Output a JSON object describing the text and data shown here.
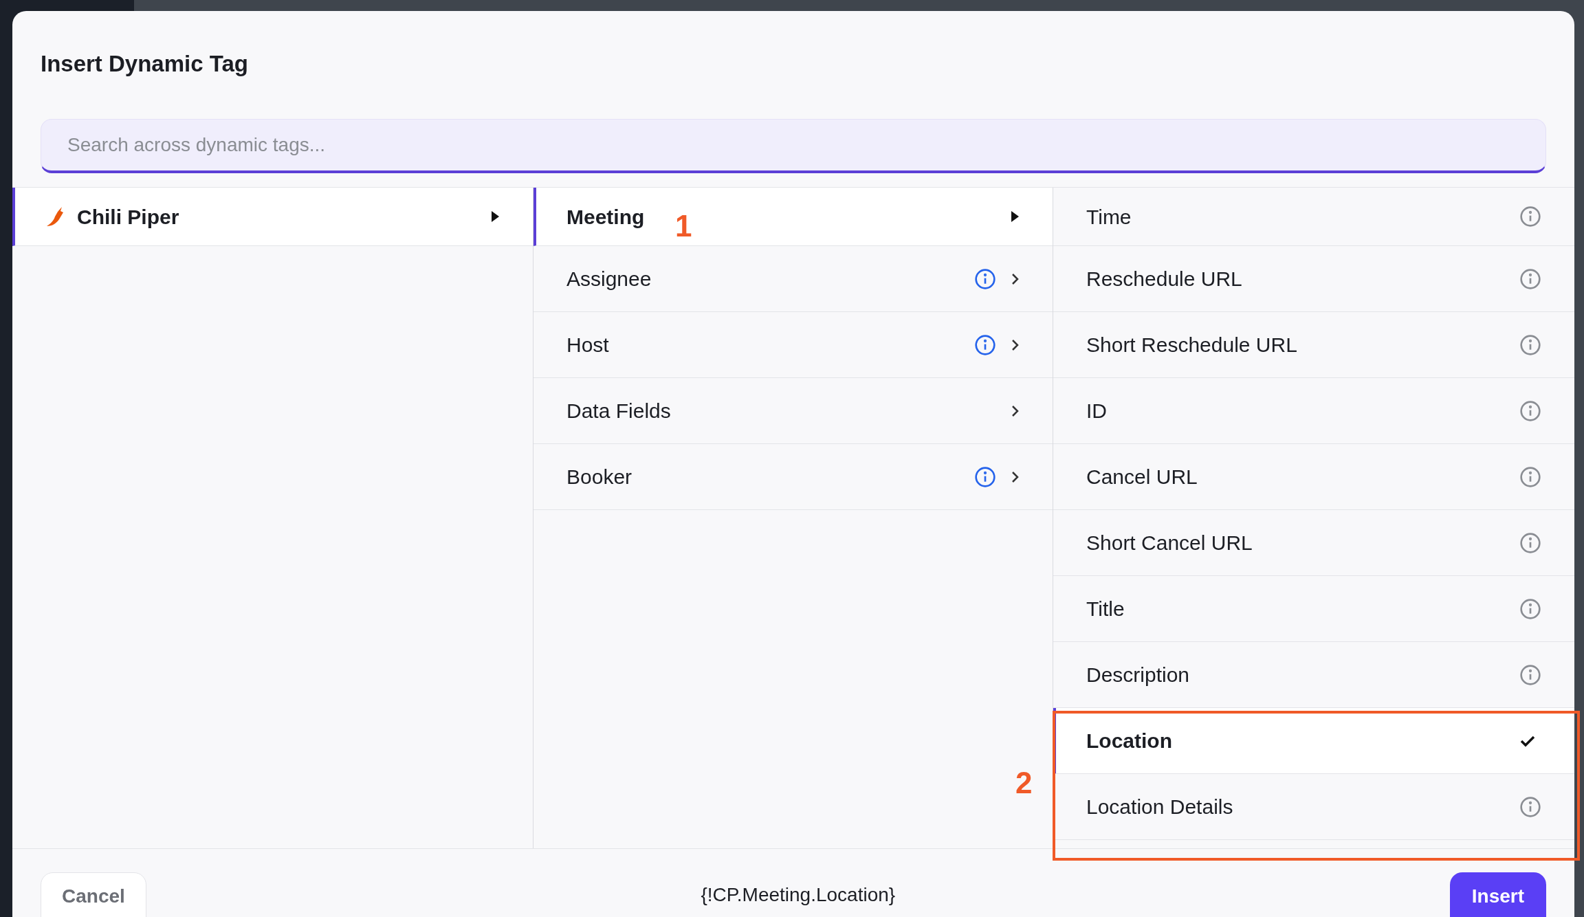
{
  "dialog": {
    "title": "Insert Dynamic Tag"
  },
  "search": {
    "placeholder": "Search across dynamic tags..."
  },
  "columns": [
    {
      "kind": "branch",
      "items": [
        {
          "label": "Chili Piper",
          "selected": true,
          "logo": true,
          "info": false
        }
      ]
    },
    {
      "kind": "branch",
      "items": [
        {
          "label": "Meeting",
          "selected": true,
          "info": false
        },
        {
          "label": "Assignee",
          "selected": false,
          "info": true
        },
        {
          "label": "Host",
          "selected": false,
          "info": true
        },
        {
          "label": "Data Fields",
          "selected": false,
          "info": false
        },
        {
          "label": "Booker",
          "selected": false,
          "info": true
        }
      ]
    },
    {
      "kind": "leaf",
      "items": [
        {
          "label": "Time",
          "selected": false,
          "info": true
        },
        {
          "label": "Reschedule URL",
          "selected": false,
          "info": true
        },
        {
          "label": "Short Reschedule URL",
          "selected": false,
          "info": true
        },
        {
          "label": "ID",
          "selected": false,
          "info": true
        },
        {
          "label": "Cancel URL",
          "selected": false,
          "info": true
        },
        {
          "label": "Short Cancel URL",
          "selected": false,
          "info": true
        },
        {
          "label": "Title",
          "selected": false,
          "info": true
        },
        {
          "label": "Description",
          "selected": false,
          "info": true
        },
        {
          "label": "Location",
          "selected": true,
          "info": false
        },
        {
          "label": "Location Details",
          "selected": false,
          "info": true
        }
      ]
    }
  ],
  "footer": {
    "cancel": "Cancel",
    "preview": "{!CP.Meeting.Location}",
    "insert": "Insert"
  },
  "annotations": [
    {
      "label": "1"
    },
    {
      "label": "2"
    }
  ]
}
